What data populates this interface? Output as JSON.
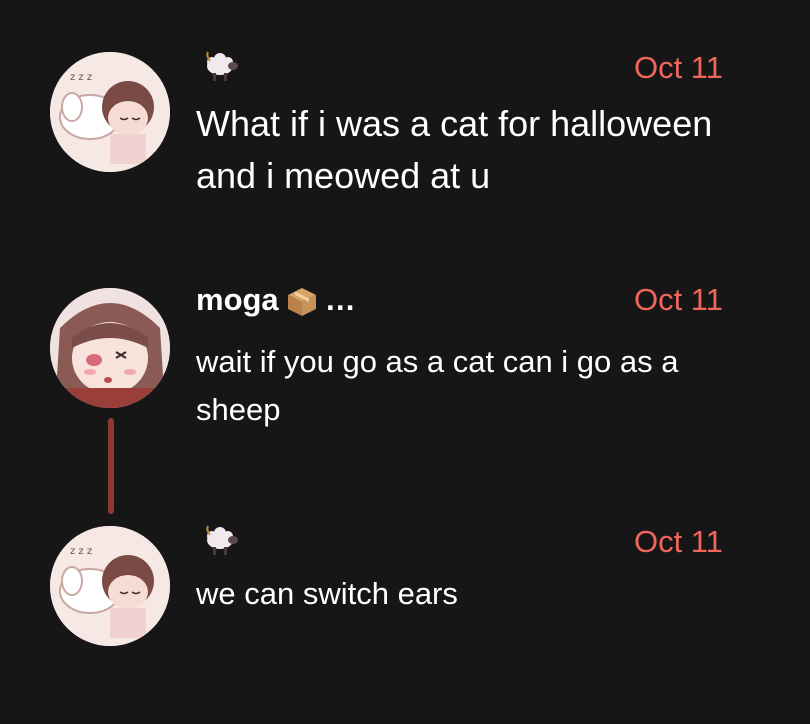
{
  "posts": [
    {
      "author": "",
      "author_icon": "sheep-icon",
      "date": "Oct 11",
      "text": "What if i was a cat for halloween and i meowed at u"
    },
    {
      "author": "moga",
      "author_icon": "package-icon",
      "author_suffix": "…",
      "date": "Oct 11",
      "text": "wait if you go as a cat can i go as a sheep"
    },
    {
      "author": "",
      "author_icon": "sheep-icon",
      "date": "Oct 11",
      "text": "we can switch ears"
    }
  ],
  "colors": {
    "background": "#171616",
    "timestamp": "#f0665c",
    "thread_line": "#8b3a33"
  }
}
